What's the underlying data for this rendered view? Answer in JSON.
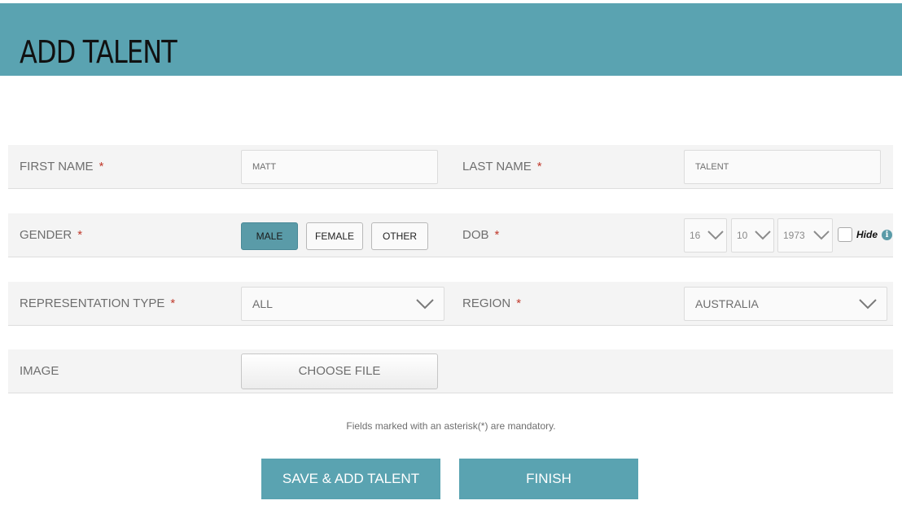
{
  "header": {
    "title": "ADD TALENT"
  },
  "form": {
    "first_name": {
      "label": "FIRST NAME",
      "required": "*",
      "value": "MATT"
    },
    "last_name": {
      "label": "LAST NAME",
      "required": "*",
      "value": "TALENT"
    },
    "gender": {
      "label": "GENDER",
      "required": "*",
      "options": [
        "MALE",
        "FEMALE",
        "OTHER"
      ],
      "selected": "MALE"
    },
    "dob": {
      "label": "DOB",
      "required": "*",
      "day": "16",
      "month": "10",
      "year": "1973",
      "hide_label": "Hide",
      "hide_checked": false,
      "info_icon": "i"
    },
    "representation_type": {
      "label": "REPRESENTATION TYPE",
      "required": "*",
      "value": "ALL"
    },
    "region": {
      "label": "REGION",
      "required": "*",
      "value": "AUSTRALIA"
    },
    "image": {
      "label": "IMAGE",
      "button": "CHOOSE FILE"
    }
  },
  "note": "Fields marked with an asterisk(*) are mandatory.",
  "actions": {
    "save_add": "SAVE & ADD TALENT",
    "finish": "FINISH"
  },
  "colors": {
    "accent": "#5aa3b1",
    "required": "#c0392b",
    "row_bg": "#f4f4f4"
  },
  "icons": {
    "select_arrow": "chevron-down-icon",
    "info": "info-icon"
  }
}
